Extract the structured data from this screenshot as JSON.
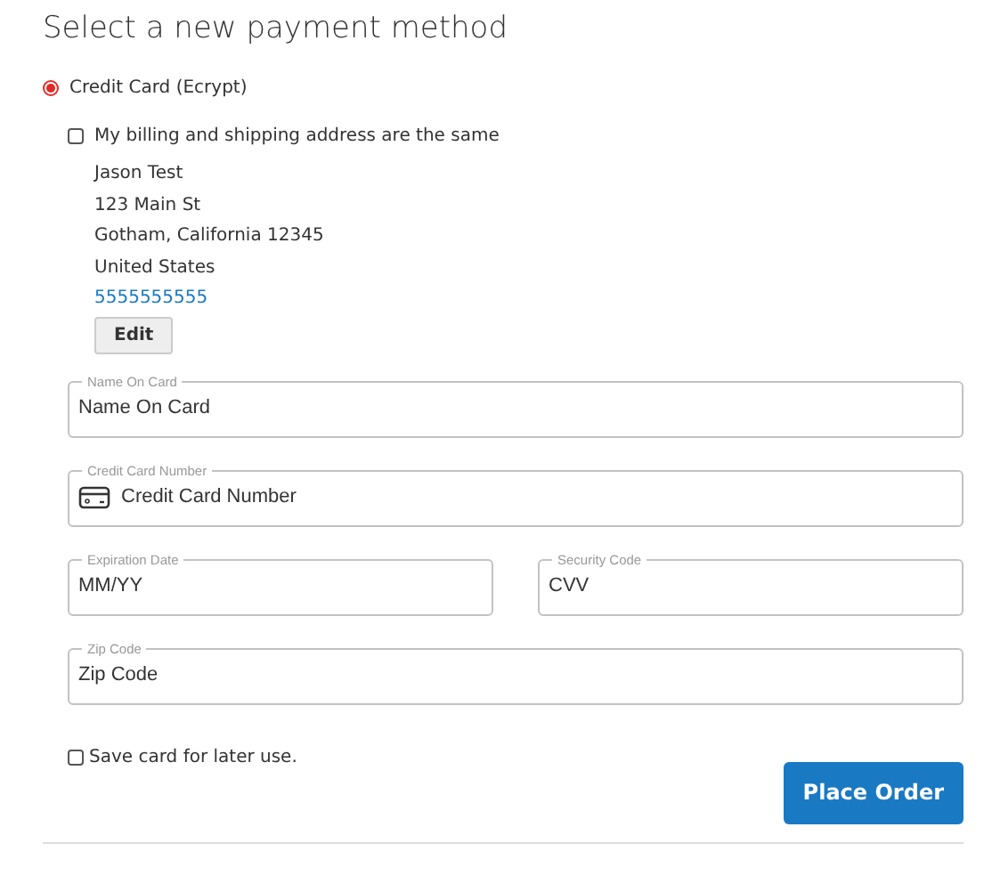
{
  "title": "Select a new payment method",
  "payment_method": {
    "label": "Credit Card (Ecrypt)",
    "selected": true
  },
  "same_address": {
    "label": "My billing and shipping address are the same",
    "checked": false
  },
  "address": {
    "lines": [
      "Jason Test",
      "123 Main St",
      "Gotham, California 12345",
      "United States"
    ],
    "phone": "5555555555",
    "edit_button": "Edit"
  },
  "field_rows": [
    [
      {
        "kind": "text",
        "label": "Name On Card",
        "placeholder": "Name On Card"
      }
    ],
    [
      {
        "kind": "card",
        "label": "Credit Card Number",
        "placeholder": "Credit Card Number"
      }
    ],
    [
      {
        "kind": "text",
        "label": "Expiration Date",
        "placeholder": "MM/YY"
      },
      {
        "kind": "text",
        "label": "Security Code",
        "placeholder": "CVV"
      }
    ],
    [
      {
        "kind": "text",
        "label": "Zip Code",
        "placeholder": "Zip Code"
      }
    ]
  ],
  "save_card": {
    "label": "Save card for later use.",
    "checked": false
  },
  "place_order_button": "Place Order"
}
